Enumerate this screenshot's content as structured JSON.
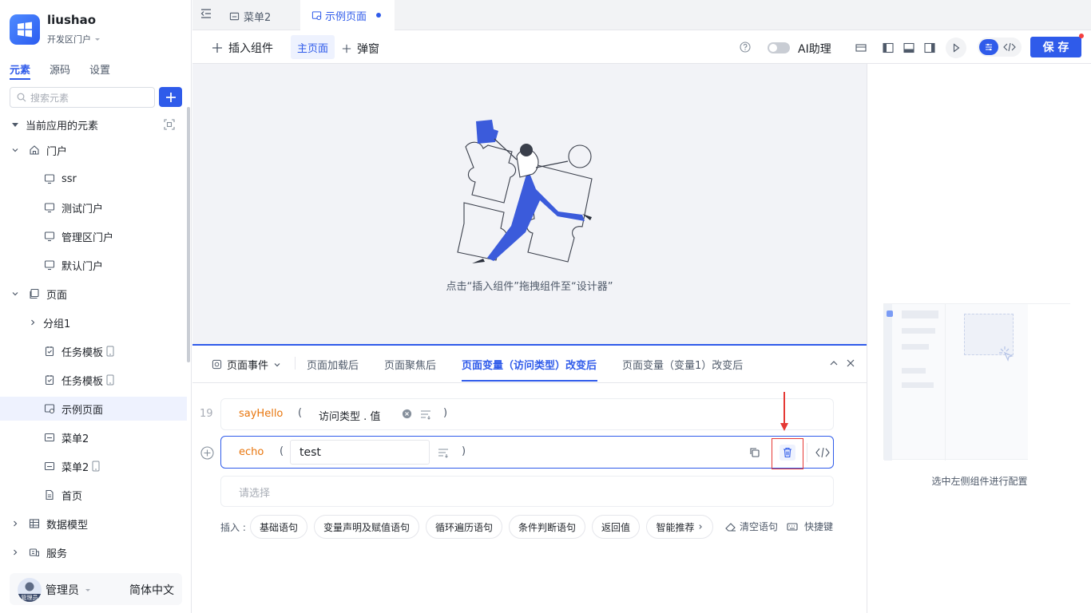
{
  "app": {
    "name": "liushao",
    "portal": "开发区门户"
  },
  "sidebar": {
    "tabs": [
      "元素",
      "源码",
      "设置"
    ],
    "search_placeholder": "搜索元素",
    "section_title": "当前应用的元素",
    "tree": [
      {
        "label": "门户"
      },
      {
        "label": "ssr"
      },
      {
        "label": "测试门户"
      },
      {
        "label": "管理区门户"
      },
      {
        "label": "默认门户"
      },
      {
        "label": "页面"
      },
      {
        "label": "分组1"
      },
      {
        "label": "任务模板"
      },
      {
        "label": "任务模板"
      },
      {
        "label": "示例页面"
      },
      {
        "label": "菜单2"
      },
      {
        "label": "菜单2"
      },
      {
        "label": "首页"
      },
      {
        "label": "数据模型"
      },
      {
        "label": "服务"
      }
    ],
    "user": {
      "name": "管理员",
      "avatar_text": "管理员",
      "language": "简体中文"
    }
  },
  "tabs": [
    {
      "label": "菜单2"
    },
    {
      "label": "示例页面"
    }
  ],
  "toolbar": {
    "insert": "插入组件",
    "main_page": "主页面",
    "popup": "弹窗",
    "ai": "AI助理",
    "save": "保 存"
  },
  "canvas": {
    "hint": "点击“插入组件”拖拽组件至“设计器”"
  },
  "bottom": {
    "event_tab": "页面事件",
    "tabs": [
      "页面加载后",
      "页面聚焦后",
      "页面变量（访问类型）改变后",
      "页面变量（变量1）改变后"
    ],
    "line_number": "19",
    "row1": {
      "func": "sayHello",
      "open": "(",
      "arg": "访问类型 . 值",
      "close": ")"
    },
    "row2": {
      "func": "echo",
      "open": "(",
      "arg": "test",
      "close": ")"
    },
    "row3": {
      "placeholder": "请选择"
    },
    "insert_label": "插入 :",
    "chips": [
      "基础语句",
      "变量声明及赋值语句",
      "循环遍历语句",
      "条件判断语句",
      "返回值",
      "智能推荐"
    ],
    "clear": "清空语句",
    "shortcut": "快捷键"
  },
  "right_panel": {
    "hint": "选中左侧组件进行配置"
  },
  "colors": {
    "accent": "#2f5bea",
    "func": "#e8750c",
    "highlight": "#e53935"
  }
}
